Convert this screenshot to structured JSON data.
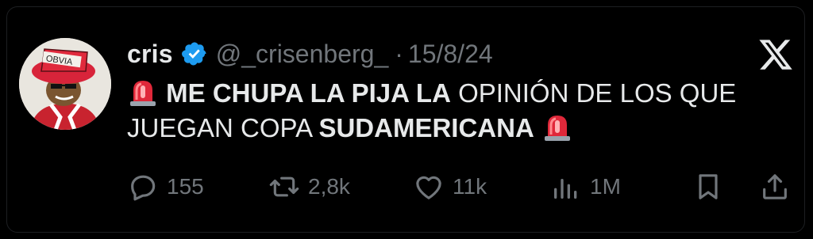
{
  "tweet": {
    "author_name": "cris",
    "handle": "@_crisenberg_",
    "separator": "·",
    "date": "15/8/24",
    "text_bold_1": "ME CHUPA LA PIJA LA",
    "text_regular_1": " OPINIÓN DE LOS QUE JUEGAN COPA ",
    "text_bold_2": "SUDAMERICANA",
    "avatar_hat_text": "OBVIA"
  },
  "actions": {
    "replies": "155",
    "reposts": "2,8k",
    "likes": "11k",
    "views": "1M"
  },
  "icons": {
    "verified": "verified-badge-icon",
    "close": "x-logo-icon",
    "siren": "rotating-light-emoji",
    "reply": "reply-bubble-icon",
    "repost": "repost-arrows-icon",
    "like": "heart-icon",
    "views": "views-bars-icon",
    "bookmark": "bookmark-icon",
    "share": "share-upload-icon"
  },
  "colors": {
    "background": "#000000",
    "text": "#e7e9ea",
    "muted": "#71767b",
    "verified": "#1d9bf0",
    "siren": "#e0283a"
  }
}
